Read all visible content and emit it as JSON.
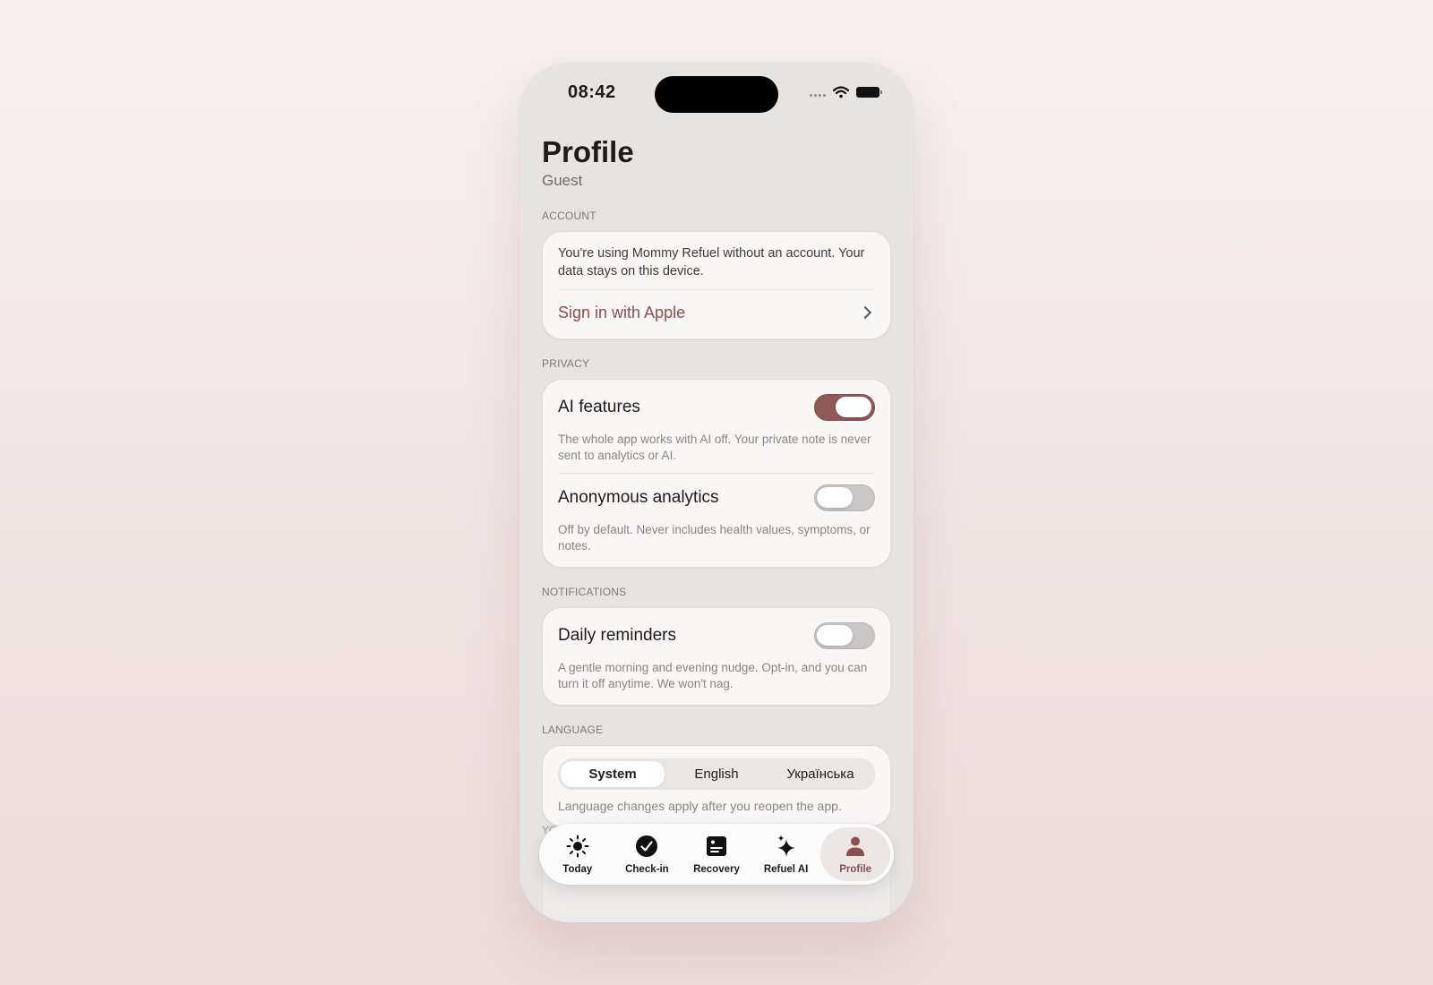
{
  "status_bar": {
    "time": "08:42"
  },
  "header": {
    "title": "Profile",
    "subtitle": "Guest"
  },
  "account": {
    "section_label": "ACCOUNT",
    "description": "You're using Mommy Refuel without an account. Your data stays on this device.",
    "sign_in_label": "Sign in with Apple"
  },
  "privacy": {
    "section_label": "PRIVACY",
    "ai_features": {
      "title": "AI features",
      "enabled": true,
      "description": "The whole app works with AI off. Your private note is never sent to analytics or AI."
    },
    "analytics": {
      "title": "Anonymous analytics",
      "enabled": false,
      "description": "Off by default. Never includes health values, symptoms, or notes."
    }
  },
  "notifications": {
    "section_label": "NOTIFICATIONS",
    "daily_reminders": {
      "title": "Daily reminders",
      "enabled": false,
      "description": "A gentle morning and evening nudge. Opt-in, and you can turn it off anytime. We won't nag."
    }
  },
  "language": {
    "section_label": "LANGUAGE",
    "options": [
      "System",
      "English",
      "Українська"
    ],
    "selected": "System",
    "note": "Language changes apply after you reopen the app."
  },
  "next_section_peek": "YO",
  "tab_bar": {
    "items": [
      {
        "label": "Today",
        "icon": "sun-icon"
      },
      {
        "label": "Check-in",
        "icon": "check-circle-icon"
      },
      {
        "label": "Recovery",
        "icon": "journal-icon"
      },
      {
        "label": "Refuel AI",
        "icon": "sparkles-icon"
      },
      {
        "label": "Profile",
        "icon": "person-icon"
      }
    ],
    "active": "Profile"
  },
  "colors": {
    "accent": "#8a4e4e",
    "toggle_on": "#8f5959",
    "card_bg": "#f8f7f6",
    "screen_bg": "#e6e3e1"
  }
}
